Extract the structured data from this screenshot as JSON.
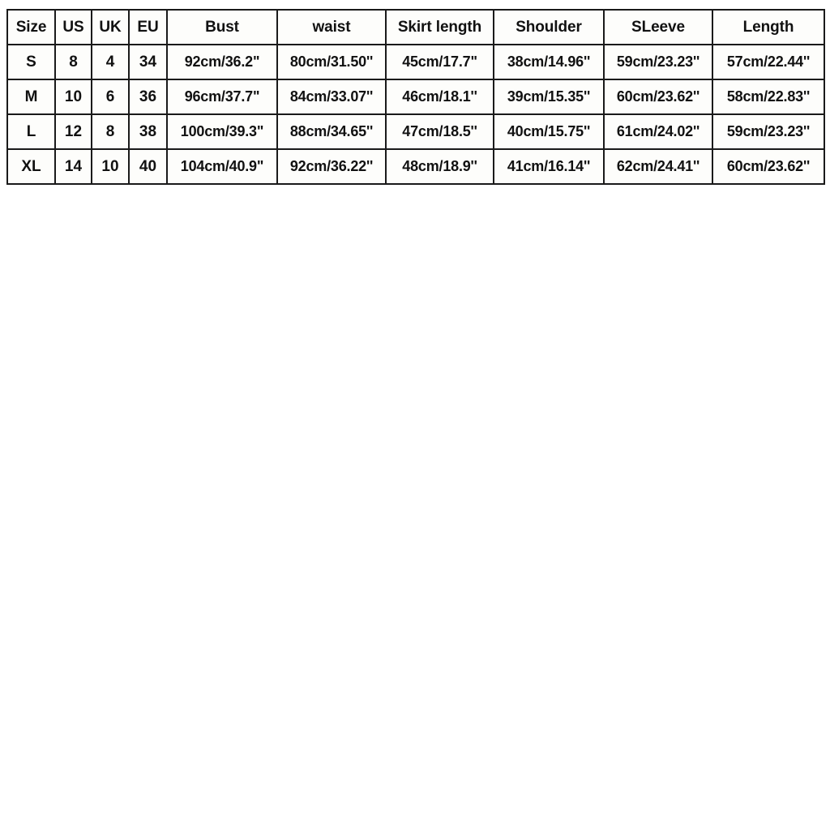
{
  "size_chart": {
    "type": "table",
    "columns": [
      "Size",
      "US",
      "UK",
      "EU",
      "Bust",
      "waist",
      "Skirt length",
      "Shoulder",
      "SLeeve",
      "Length"
    ],
    "rows": [
      {
        "size": "S",
        "us": "8",
        "uk": "4",
        "eu": "34",
        "bust": "92cm/36.2\"",
        "waist": "80cm/31.50''",
        "skirt_length": "45cm/17.7\"",
        "shoulder": "38cm/14.96''",
        "sleeve": "59cm/23.23''",
        "length": "57cm/22.44''"
      },
      {
        "size": "M",
        "us": "10",
        "uk": "6",
        "eu": "36",
        "bust": "96cm/37.7\"",
        "waist": "84cm/33.07''",
        "skirt_length": "46cm/18.1''",
        "shoulder": "39cm/15.35''",
        "sleeve": "60cm/23.62''",
        "length": "58cm/22.83''"
      },
      {
        "size": "L",
        "us": "12",
        "uk": "8",
        "eu": "38",
        "bust": "100cm/39.3\"",
        "waist": "88cm/34.65''",
        "skirt_length": "47cm/18.5''",
        "shoulder": "40cm/15.75''",
        "sleeve": "61cm/24.02''",
        "length": "59cm/23.23''"
      },
      {
        "size": "XL",
        "us": "14",
        "uk": "10",
        "eu": "40",
        "bust": "104cm/40.9\"",
        "waist": "92cm/36.22''",
        "skirt_length": "48cm/18.9''",
        "shoulder": "41cm/16.14''",
        "sleeve": "62cm/24.41''",
        "length": "60cm/23.62''"
      }
    ],
    "colors": {
      "border": "#1a1a1a",
      "text": "#111111",
      "cell_background": "#fdfdfb",
      "page_background": "#ffffff"
    }
  }
}
